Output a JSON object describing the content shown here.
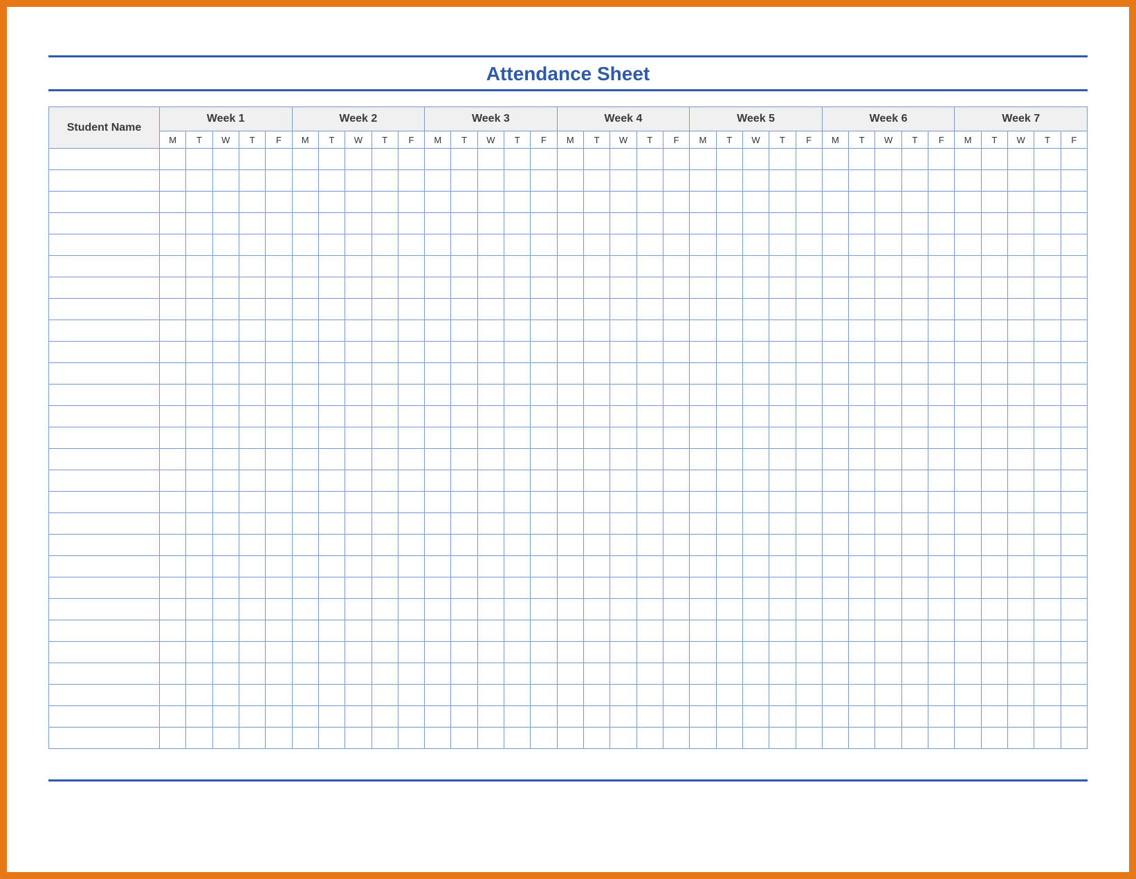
{
  "title": "Attendance Sheet",
  "headers": {
    "student_name": "Student Name",
    "weeks": [
      "Week 1",
      "Week 2",
      "Week 3",
      "Week 4",
      "Week 5",
      "Week 6",
      "Week 7"
    ]
  },
  "days": [
    "M",
    "T",
    "W",
    "T",
    "F"
  ],
  "row_count": 28,
  "colors": {
    "frame": "#e67817",
    "rule": "#2f5aa8",
    "grid": "#7a9bc4",
    "header_bg": "#f0f0f0"
  }
}
